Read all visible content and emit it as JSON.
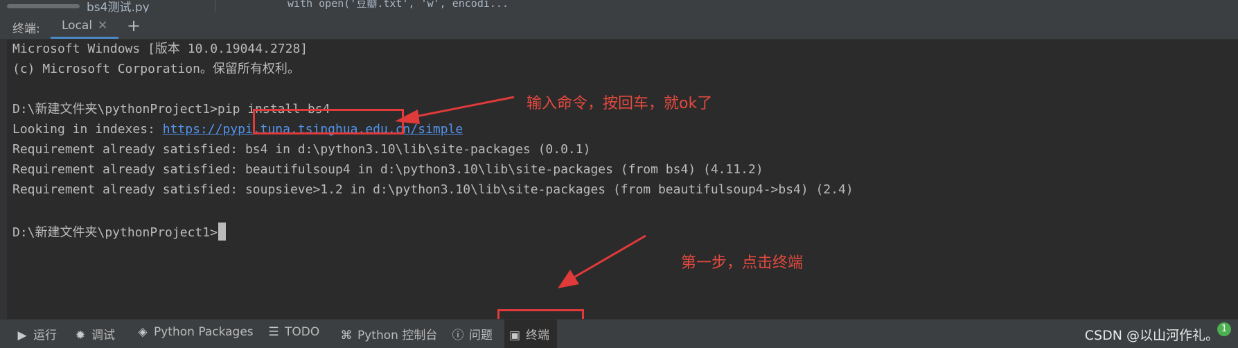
{
  "top_strip": {
    "file_tab": "bs4测试.py",
    "code_snippet": "with open('豆瓣.txt', 'w', encodi..."
  },
  "terminal_header": {
    "label": "终端:",
    "tab_name": "Local",
    "close_glyph": "✕",
    "add_glyph": "+"
  },
  "terminal": {
    "lines": [
      "Microsoft Windows [版本 10.0.19044.2728]",
      "(c) Microsoft Corporation。保留所有权利。",
      "",
      "D:\\新建文件夹\\pythonProject1>pip install bs4",
      "Looking in indexes: ",
      "Requirement already satisfied: bs4 in d:\\python3.10\\lib\\site-packages (0.0.1)",
      "Requirement already satisfied: beautifulsoup4 in d:\\python3.10\\lib\\site-packages (from bs4) (4.11.2)",
      "Requirement already satisfied: soupsieve>1.2 in d:\\python3.10\\lib\\site-packages (from beautifulsoup4->bs4) (2.4)",
      "",
      "D:\\新建文件夹\\pythonProject1>"
    ],
    "index_url": "https://pypi.tuna.tsinghua.edu.cn/simple"
  },
  "annotations": {
    "command_note": "输入命令，按回车，就ok了",
    "step_note": "第一步，点击终端",
    "color": "#e03a3a"
  },
  "toolbar": {
    "run": {
      "label": "运行",
      "icon": "play-icon"
    },
    "debug": {
      "label": "调试",
      "icon": "bug-icon"
    },
    "packages": {
      "label": "Python Packages",
      "icon": "layers-icon"
    },
    "todo": {
      "label": "TODO",
      "icon": "list-icon"
    },
    "console": {
      "label": "Python 控制台",
      "icon": "python-icon"
    },
    "problems": {
      "label": "问题",
      "icon": "warning-icon"
    },
    "terminal": {
      "label": "终端",
      "icon": "terminal-icon"
    }
  },
  "watermark": {
    "text": "CSDN @以山河作礼。",
    "badge": "1"
  }
}
